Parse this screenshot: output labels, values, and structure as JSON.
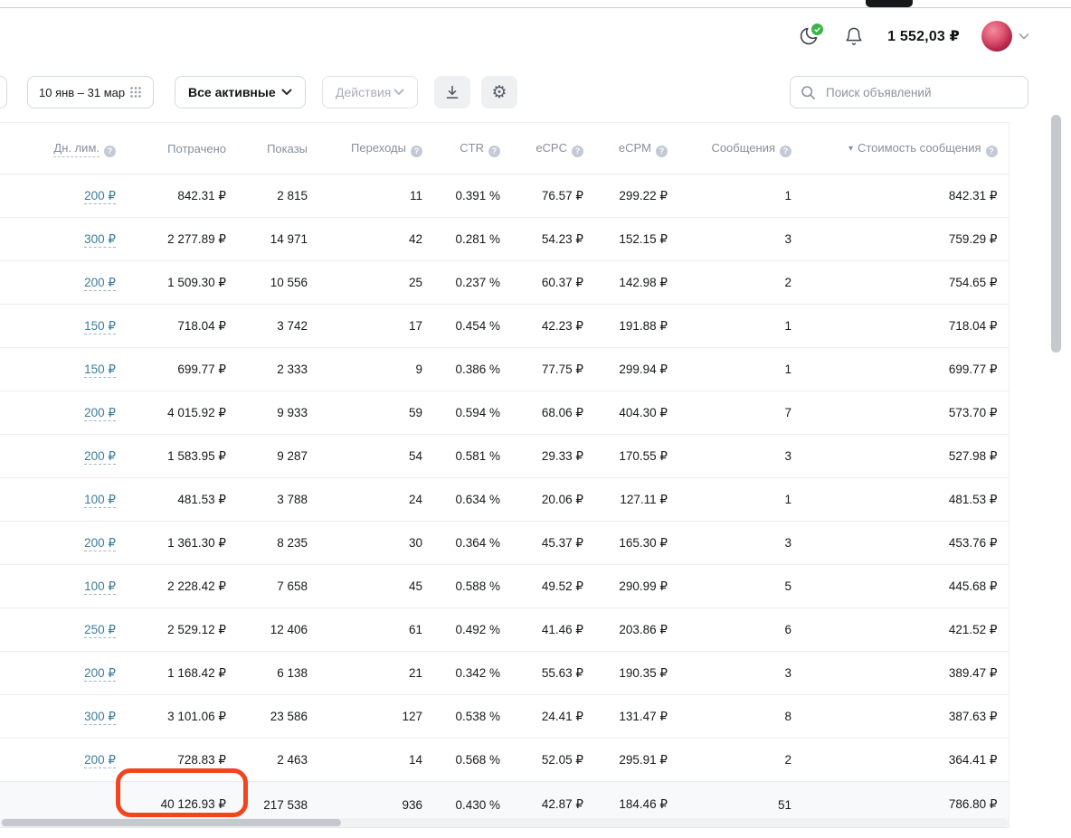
{
  "topbar": {
    "balance": "1 552,03 ₽"
  },
  "toolbar": {
    "date_range": "10 янв – 31 мар",
    "filter_label": "Все активные",
    "actions_label": "Действия",
    "search_placeholder": "Поиск объявлений"
  },
  "icons": {
    "gear_glyph": "⚙",
    "sort_desc": "▾",
    "info_glyph": "?"
  },
  "table": {
    "columns": [
      {
        "key": "daily-limit",
        "label": "Дн. лим.",
        "info": true,
        "dashed": true
      },
      {
        "key": "spent",
        "label": "Потрачено",
        "info": false
      },
      {
        "key": "impressions",
        "label": "Показы",
        "info": false
      },
      {
        "key": "clicks",
        "label": "Переходы",
        "info": true
      },
      {
        "key": "ctr",
        "label": "CTR",
        "info": true
      },
      {
        "key": "ecpc",
        "label": "eCPC",
        "info": true
      },
      {
        "key": "ecpm",
        "label": "eCPM",
        "info": true
      },
      {
        "key": "messages",
        "label": "Сообщения",
        "info": true
      },
      {
        "key": "cost-per-message",
        "label": "Стоимость сообщения",
        "info": true,
        "sorted": true
      }
    ],
    "rows": [
      [
        "200 ₽",
        "842.31 ₽",
        "2 815",
        "11",
        "0.391 %",
        "76.57 ₽",
        "299.22 ₽",
        "1",
        "842.31 ₽"
      ],
      [
        "300 ₽",
        "2 277.89 ₽",
        "14 971",
        "42",
        "0.281 %",
        "54.23 ₽",
        "152.15 ₽",
        "3",
        "759.29 ₽"
      ],
      [
        "200 ₽",
        "1 509.30 ₽",
        "10 556",
        "25",
        "0.237 %",
        "60.37 ₽",
        "142.98 ₽",
        "2",
        "754.65 ₽"
      ],
      [
        "150 ₽",
        "718.04 ₽",
        "3 742",
        "17",
        "0.454 %",
        "42.23 ₽",
        "191.88 ₽",
        "1",
        "718.04 ₽"
      ],
      [
        "150 ₽",
        "699.77 ₽",
        "2 333",
        "9",
        "0.386 %",
        "77.75 ₽",
        "299.94 ₽",
        "1",
        "699.77 ₽"
      ],
      [
        "200 ₽",
        "4 015.92 ₽",
        "9 933",
        "59",
        "0.594 %",
        "68.06 ₽",
        "404.30 ₽",
        "7",
        "573.70 ₽"
      ],
      [
        "200 ₽",
        "1 583.95 ₽",
        "9 287",
        "54",
        "0.581 %",
        "29.33 ₽",
        "170.55 ₽",
        "3",
        "527.98 ₽"
      ],
      [
        "100 ₽",
        "481.53 ₽",
        "3 788",
        "24",
        "0.634 %",
        "20.06 ₽",
        "127.11 ₽",
        "1",
        "481.53 ₽"
      ],
      [
        "200 ₽",
        "1 361.30 ₽",
        "8 235",
        "30",
        "0.364 %",
        "45.37 ₽",
        "165.30 ₽",
        "3",
        "453.76 ₽"
      ],
      [
        "100 ₽",
        "2 228.42 ₽",
        "7 658",
        "45",
        "0.588 %",
        "49.52 ₽",
        "290.99 ₽",
        "5",
        "445.68 ₽"
      ],
      [
        "250 ₽",
        "2 529.12 ₽",
        "12 406",
        "61",
        "0.492 %",
        "41.46 ₽",
        "203.86 ₽",
        "6",
        "421.52 ₽"
      ],
      [
        "200 ₽",
        "1 168.42 ₽",
        "6 138",
        "21",
        "0.342 %",
        "55.63 ₽",
        "190.35 ₽",
        "3",
        "389.47 ₽"
      ],
      [
        "300 ₽",
        "3 101.06 ₽",
        "23 586",
        "127",
        "0.538 %",
        "24.41 ₽",
        "131.47 ₽",
        "8",
        "387.63 ₽"
      ],
      [
        "200 ₽",
        "728.83 ₽",
        "2 463",
        "14",
        "0.568 %",
        "52.05 ₽",
        "295.91 ₽",
        "2",
        "364.41 ₽"
      ]
    ],
    "total": [
      "",
      "40 126.93 ₽",
      "217 538",
      "936",
      "0.430 %",
      "42.87 ₽",
      "184.46 ₽",
      "51",
      "786.80 ₽"
    ]
  }
}
